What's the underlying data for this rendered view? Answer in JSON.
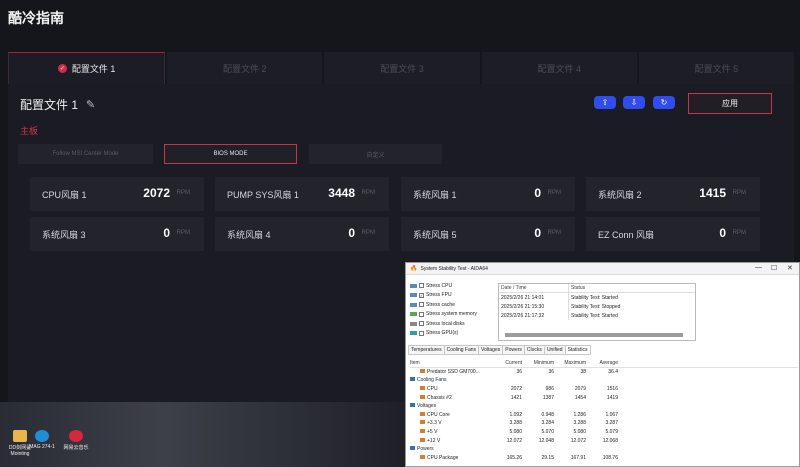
{
  "app": {
    "title": "酷冷指南"
  },
  "tabs": [
    {
      "label": "配置文件 1",
      "active": true
    },
    {
      "label": "配置文件 2"
    },
    {
      "label": "配置文件 3"
    },
    {
      "label": "配置文件 4"
    },
    {
      "label": "配置文件 5"
    }
  ],
  "profile": {
    "title": "配置文件 1",
    "apply_label": "应用",
    "section_label": "主板",
    "modes": [
      {
        "label": "Follow MSI Center Mode"
      },
      {
        "label": "BIOS MODE",
        "active": true
      },
      {
        "label": "自定义"
      }
    ],
    "fan_unit": "RPM",
    "fans": [
      {
        "name": "CPU风扇 1",
        "value": "2072"
      },
      {
        "name": "PUMP SYS风扇 1",
        "value": "3448"
      },
      {
        "name": "系统风扇 1",
        "value": "0"
      },
      {
        "name": "系统风扇 2",
        "value": "1415"
      },
      {
        "name": "系统风扇 3",
        "value": "0"
      },
      {
        "name": "系统风扇 4",
        "value": "0"
      },
      {
        "name": "系统风扇 5",
        "value": "0"
      },
      {
        "name": "EZ Conn 风扇",
        "value": "0"
      }
    ]
  },
  "desktop": {
    "icons": [
      {
        "label": "DD剑网鲨 Mointing",
        "icon": "folder-icon",
        "color": "#e8b64a"
      },
      {
        "label": "MAG 274-1",
        "icon": "edge-icon",
        "color": "#1d8ed8"
      },
      {
        "label": "网易云音乐",
        "icon": "music-icon",
        "color": "#d8263a"
      }
    ]
  },
  "aida": {
    "title": "System Stability Test - AIDA64",
    "stress_items": [
      {
        "label": "Stress CPU",
        "checked": false
      },
      {
        "label": "Stress FPU",
        "checked": true
      },
      {
        "label": "Stress cache",
        "checked": false
      },
      {
        "label": "Stress system memory",
        "checked": false
      },
      {
        "label": "Stress local disks",
        "checked": false
      },
      {
        "label": "Stress GPU(s)",
        "checked": false
      }
    ],
    "log_headers": [
      "Date / Time",
      "Status"
    ],
    "log_rows": [
      {
        "time": "2025/2/26 21:14:01",
        "status": "Stability Test: Started"
      },
      {
        "time": "2025/2/26 21:15:30",
        "status": "Stability Test: Stopped"
      },
      {
        "time": "2025/2/26 21:17:32",
        "status": "Stability Test: Started"
      }
    ],
    "tabs": [
      "Temperatures",
      "Cooling Fans",
      "Voltages",
      "Powers",
      "Clocks",
      "Unified",
      "Statistics"
    ],
    "active_tab": "Statistics",
    "stat_headers": [
      "Item",
      "Current",
      "Minimum",
      "Maximum",
      "Average"
    ],
    "stat_rows": [
      {
        "item": "Predator SSD GM700...",
        "cur": "36",
        "min": "36",
        "max": "38",
        "avg": "36.4",
        "kind": "sub"
      },
      {
        "item": "Cooling Fans",
        "kind": "group"
      },
      {
        "item": "CPU",
        "cur": "2072",
        "min": "986",
        "max": "2079",
        "avg": "1516",
        "kind": "sub"
      },
      {
        "item": "Chassis #2",
        "cur": "1421",
        "min": "1387",
        "max": "1454",
        "avg": "1419",
        "kind": "sub"
      },
      {
        "item": "Voltages",
        "kind": "group"
      },
      {
        "item": "CPU Core",
        "cur": "1.092",
        "min": "0.948",
        "max": "1.286",
        "avg": "1.067",
        "kind": "sub"
      },
      {
        "item": "+3.3 V",
        "cur": "3.288",
        "min": "3.284",
        "max": "3.288",
        "avg": "3.287",
        "kind": "sub"
      },
      {
        "item": "+5 V",
        "cur": "5.080",
        "min": "5.070",
        "max": "5.080",
        "avg": "5.079",
        "kind": "sub"
      },
      {
        "item": "+12 V",
        "cur": "12.072",
        "min": "12.048",
        "max": "12.072",
        "avg": "12.068",
        "kind": "sub"
      },
      {
        "item": "Powers",
        "kind": "group"
      },
      {
        "item": "CPU Package",
        "cur": "165.26",
        "min": "29.15",
        "max": "167.91",
        "avg": "108.76",
        "kind": "sub"
      }
    ]
  }
}
